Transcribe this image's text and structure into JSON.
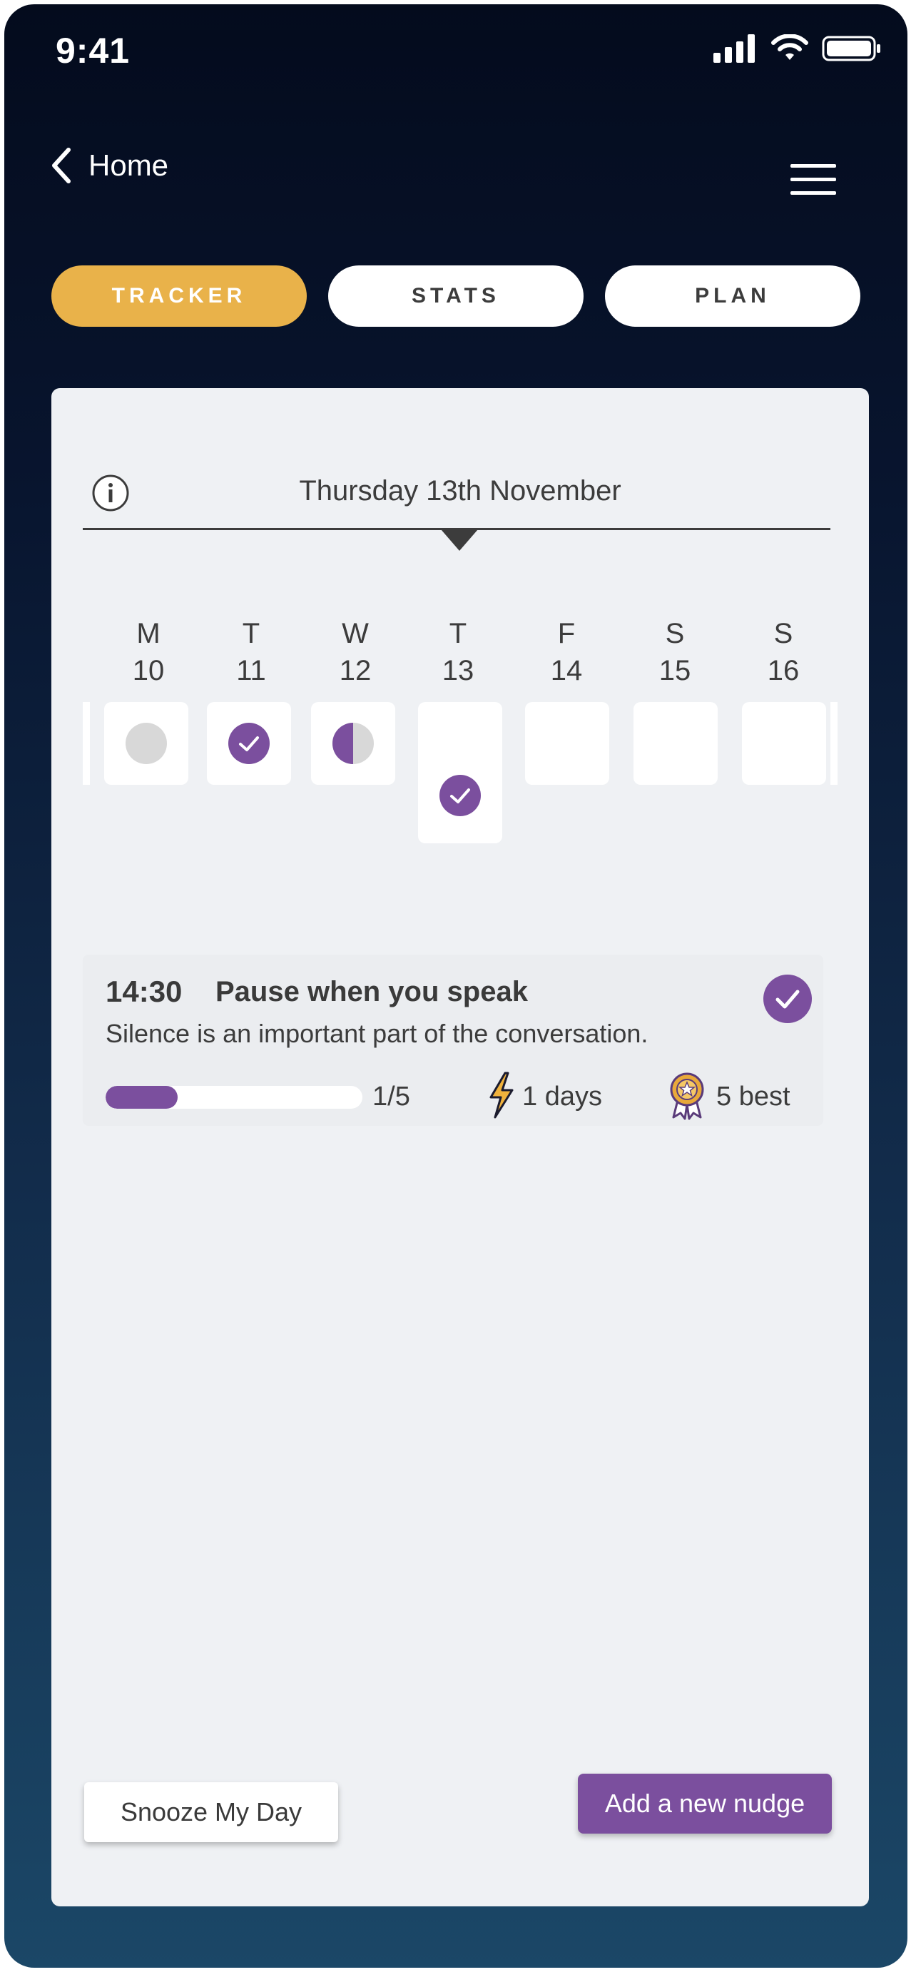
{
  "status_bar": {
    "time": "9:41"
  },
  "nav": {
    "back_label": "Home"
  },
  "tabs": [
    {
      "label": "TRACKER",
      "active": true
    },
    {
      "label": "STATS",
      "active": false
    },
    {
      "label": "PLAN",
      "active": false
    }
  ],
  "tracker": {
    "date_title": "Thursday 13th November",
    "days": [
      {
        "letter": "M",
        "number": "10",
        "status": "missed"
      },
      {
        "letter": "T",
        "number": "11",
        "status": "complete"
      },
      {
        "letter": "W",
        "number": "12",
        "status": "partial"
      },
      {
        "letter": "T",
        "number": "13",
        "status": "complete",
        "today": true
      },
      {
        "letter": "F",
        "number": "14",
        "status": "empty"
      },
      {
        "letter": "S",
        "number": "15",
        "status": "empty"
      },
      {
        "letter": "S",
        "number": "16",
        "status": "empty"
      }
    ]
  },
  "nudge": {
    "time": "14:30",
    "title": "Pause when you speak",
    "description": "Silence is an important part of the conversation.",
    "progress_label": "1/5",
    "progress_value": 0.28,
    "streak_label": "1 days",
    "best_label": "5 best"
  },
  "actions": {
    "snooze_label": "Snooze My Day",
    "add_label": "Add a new nudge"
  },
  "colors": {
    "accent_purple": "#7b4f9e",
    "tab_active": "#e9b24a",
    "card_bg": "#eff1f4"
  }
}
